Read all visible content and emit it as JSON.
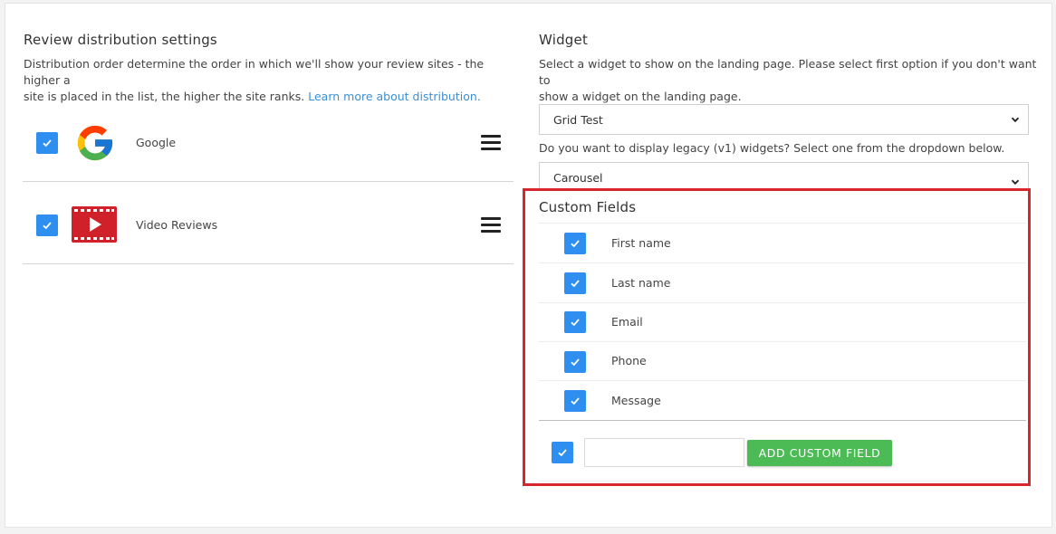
{
  "left": {
    "title": "Review distribution settings",
    "description_line1": "Distribution order determine the order in which we'll show your review sites - the higher a",
    "description_line2": "site is placed in the list, the higher the site ranks.",
    "learn_more": "Learn more about distribution.",
    "sites": [
      {
        "name": "Google",
        "checked": true,
        "icon": "google-logo-icon"
      },
      {
        "name": "Video Reviews",
        "checked": true,
        "icon": "video-reviews-icon"
      }
    ]
  },
  "right": {
    "title": "Widget",
    "description_line1": "Select a widget to show on the landing page. Please select first option if you don't want to",
    "description_line2": "show a widget on the landing page.",
    "widget_select_value": "Grid Test",
    "legacy_question": "Do you want to display legacy (v1) widgets? Select one from the dropdown below.",
    "legacy_select_value": "Carousel",
    "custom_fields": {
      "title": "Custom Fields",
      "fields": [
        {
          "label": "First name",
          "checked": true
        },
        {
          "label": "Last name",
          "checked": true
        },
        {
          "label": "Email",
          "checked": true
        },
        {
          "label": "Phone",
          "checked": true
        },
        {
          "label": "Message",
          "checked": true
        }
      ],
      "new_field_value": "",
      "add_button_label": "ADD CUSTOM FIELD"
    }
  },
  "colors": {
    "checkbox": "#2e8ff0",
    "highlight_border": "#d7262d",
    "add_button": "#4cbb55",
    "link": "#3a8fd6"
  }
}
